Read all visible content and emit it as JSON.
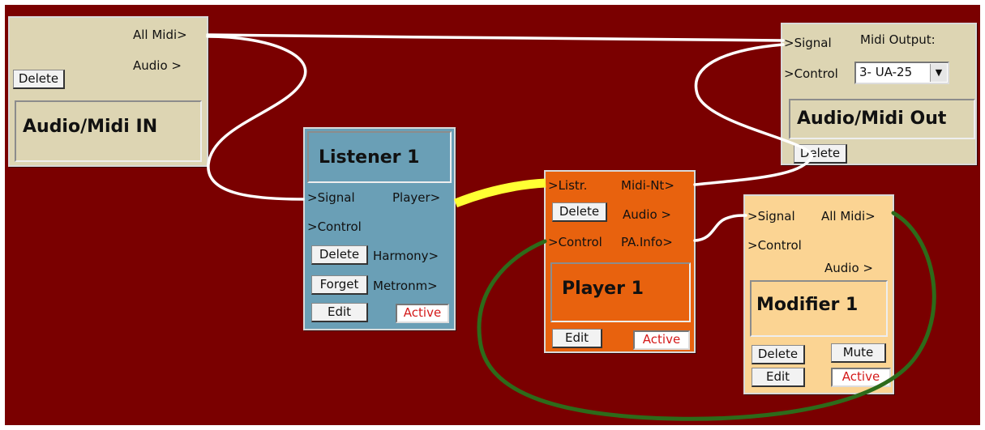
{
  "colors": {
    "background": "#7a0000",
    "audio_node": "#ddd5b3",
    "listener": "#6a9fb6",
    "player": "#e8620e",
    "modifier": "#fbd493",
    "active_text": "#d41a1a",
    "wire_white": "#ffffff",
    "wire_yellow": "#ffff33",
    "wire_green": "#2d6b1a"
  },
  "midi_in": {
    "title": "Audio/Midi IN",
    "out_all_midi": "All Midi>",
    "out_audio": "Audio  >",
    "delete": "Delete"
  },
  "midi_out": {
    "in_signal": ">Signal",
    "in_control": ">Control",
    "output_label": "Midi Output:",
    "output_value": "3- UA-25",
    "title": "Audio/Midi Out",
    "delete": "Delete"
  },
  "listener": {
    "title": "Listener 1",
    "in_signal": ">Signal",
    "in_control": ">Control",
    "out_player": "Player>",
    "out_harmony": "Harmony>",
    "out_metronome": "Metronm>",
    "delete": "Delete",
    "forget": "Forget",
    "edit": "Edit",
    "status": "Active"
  },
  "player": {
    "title": "Player 1",
    "in_listr": ">Listr.",
    "in_control": ">Control",
    "out_midi_nt": "Midi-Nt>",
    "out_audio": "Audio  >",
    "out_pa_info": "PA.Info>",
    "delete": "Delete",
    "edit": "Edit",
    "status": "Active"
  },
  "modifier": {
    "title": "Modifier 1",
    "in_signal": ">Signal",
    "in_control": ">Control",
    "out_all_midi": "All Midi>",
    "out_audio": "Audio  >",
    "delete": "Delete",
    "edit": "Edit",
    "mute": "Mute",
    "status": "Active"
  }
}
